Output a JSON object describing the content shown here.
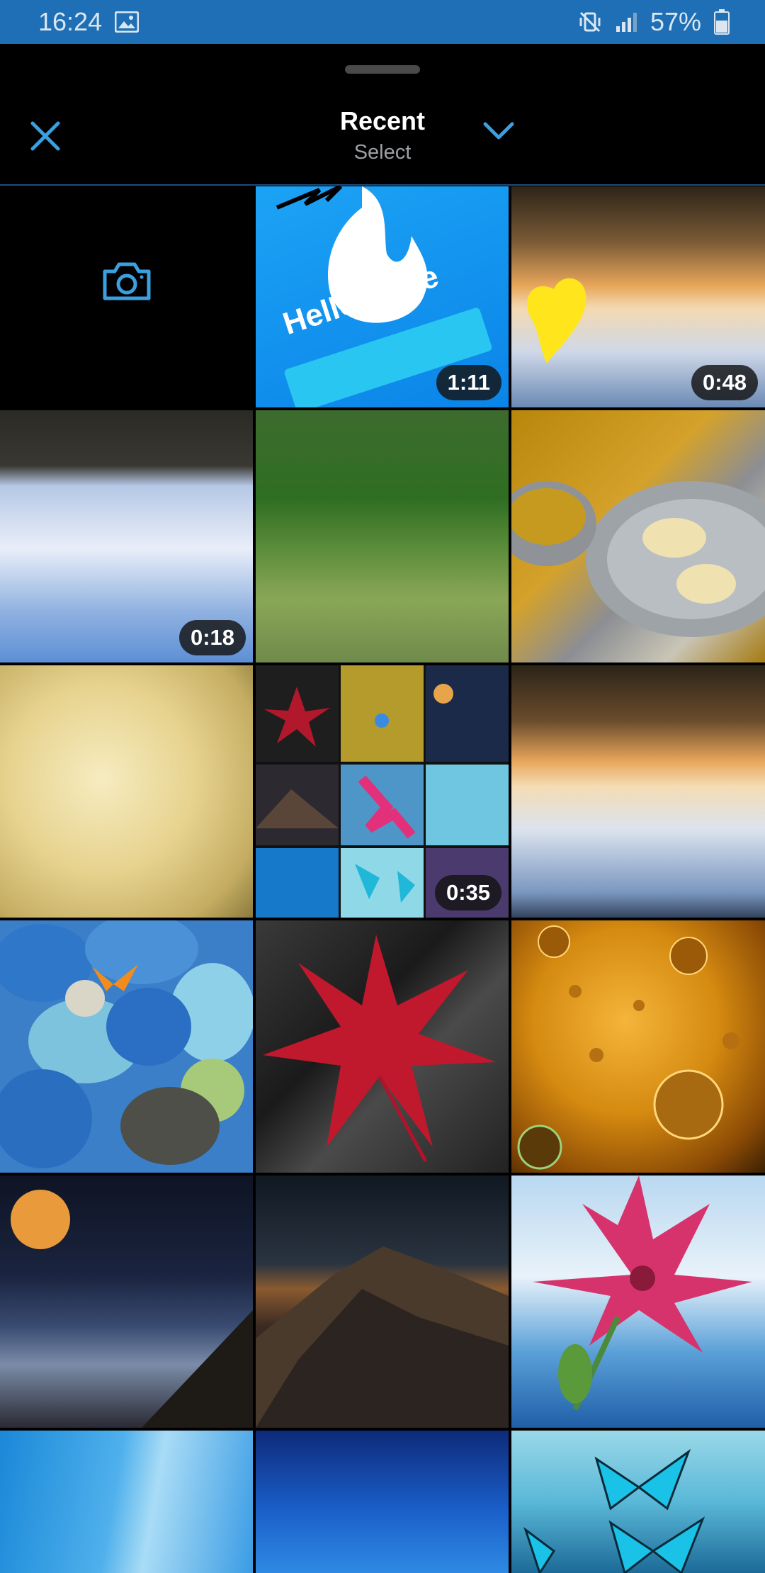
{
  "status_bar": {
    "time": "16:24",
    "battery": "57%",
    "icons": [
      "gallery-notification-icon",
      "vibrate-mute-icon",
      "signal-icon",
      "battery-icon"
    ]
  },
  "header": {
    "title": "Recent",
    "subtitle": "Select",
    "close_icon": "close-icon",
    "dropdown_icon": "chevron-down-icon"
  },
  "colors": {
    "accent": "#3aa0e0",
    "status_bar": "#1e6fb5",
    "background": "#000000"
  },
  "grid": {
    "camera_tile_icon": "camera-icon",
    "items": [
      {
        "name": "hello-there-video",
        "duration": "1:11",
        "overlay_text": "Hello there"
      },
      {
        "name": "crystal-ball-heart-video",
        "duration": "0:48"
      },
      {
        "name": "clouds-video",
        "duration": "0:18"
      },
      {
        "name": "forest-field-photo"
      },
      {
        "name": "dumplings-plate-photo"
      },
      {
        "name": "dumplings-closeup-photo"
      },
      {
        "name": "wallpaper-collage-video",
        "duration": "0:35"
      },
      {
        "name": "crystal-ball-sunset-photo"
      },
      {
        "name": "pebbles-butterfly-photo"
      },
      {
        "name": "red-leaf-photo"
      },
      {
        "name": "golden-drops-photo"
      },
      {
        "name": "moon-beach-photo"
      },
      {
        "name": "mountain-dusk-photo"
      },
      {
        "name": "pink-lily-photo"
      },
      {
        "name": "blue-waves-photo"
      },
      {
        "name": "blue-gradient-photo"
      },
      {
        "name": "blue-butterflies-photo"
      }
    ]
  }
}
